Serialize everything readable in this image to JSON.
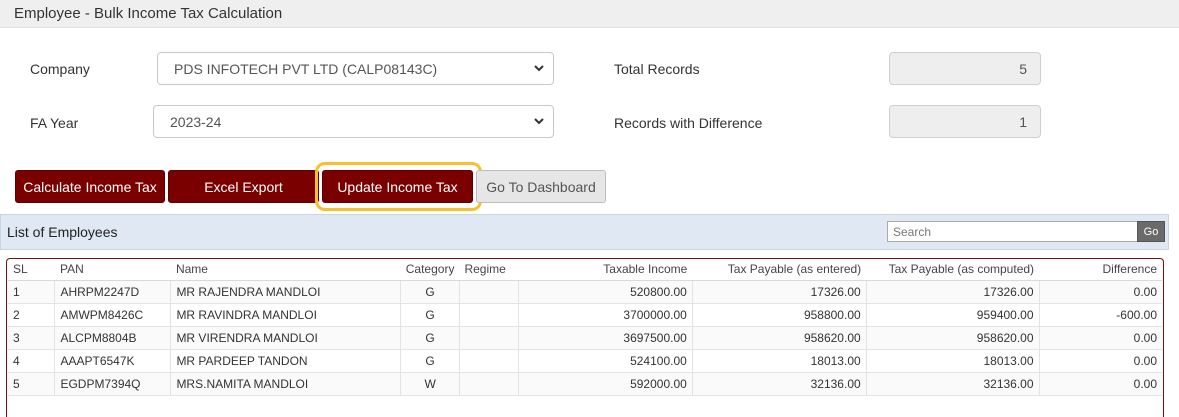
{
  "page_title": "Employee - Bulk Income Tax Calculation",
  "form": {
    "company_label": "Company",
    "company_value": "PDS INFOTECH PVT LTD (CALP08143C)",
    "fa_year_label": "FA Year",
    "fa_year_value": "2023-24",
    "total_records_label": "Total Records",
    "total_records_value": "5",
    "records_diff_label": "Records with Difference",
    "records_diff_value": "1"
  },
  "buttons": {
    "calculate": "Calculate Income Tax",
    "excel_export": "Excel Export",
    "update": "Update Income Tax",
    "dashboard": "Go To Dashboard"
  },
  "list": {
    "title": "List of Employees",
    "search_placeholder": "Search",
    "go_label": "Go",
    "columns": [
      "SL",
      "PAN",
      "Name",
      "Category",
      "Regime",
      "Taxable Income",
      "Tax Payable (as entered)",
      "Tax Payable (as computed)",
      "Difference"
    ],
    "rows": [
      {
        "sl": "1",
        "pan": "AHRPM2247D",
        "name": "MR RAJENDRA MANDLOI",
        "category": "G",
        "regime": "",
        "taxable": "520800.00",
        "entered": "17326.00",
        "computed": "17326.00",
        "difference": "0.00"
      },
      {
        "sl": "2",
        "pan": "AMWPM8426C",
        "name": "MR RAVINDRA MANDLOI",
        "category": "G",
        "regime": "",
        "taxable": "3700000.00",
        "entered": "958800.00",
        "computed": "959400.00",
        "difference": "-600.00"
      },
      {
        "sl": "3",
        "pan": "ALCPM8804B",
        "name": "MR VIRENDRA MANDLOI",
        "category": "G",
        "regime": "",
        "taxable": "3697500.00",
        "entered": "958620.00",
        "computed": "958620.00",
        "difference": "0.00"
      },
      {
        "sl": "4",
        "pan": "AAAPT6547K",
        "name": "MR PARDEEP TANDON",
        "category": "G",
        "regime": "",
        "taxable": "524100.00",
        "entered": "18013.00",
        "computed": "18013.00",
        "difference": "0.00"
      },
      {
        "sl": "5",
        "pan": "EGDPM7394Q",
        "name": "MRS.NAMITA MANDLOI",
        "category": "W",
        "regime": "",
        "taxable": "592000.00",
        "entered": "32136.00",
        "computed": "32136.00",
        "difference": "0.00"
      }
    ]
  },
  "icons": {
    "dropdown": "chevron-down-icon"
  },
  "colors": {
    "primary_button": "#7a0000",
    "highlight": "#f6c12c",
    "panel_header": "#dfe8f3"
  }
}
